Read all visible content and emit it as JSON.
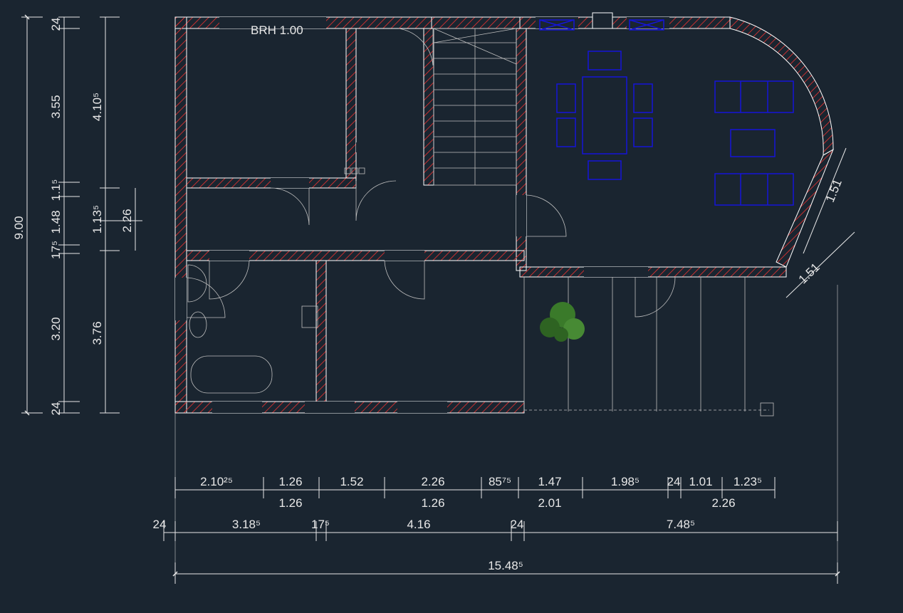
{
  "room_label": "BRH 1.00",
  "dimensions": {
    "vertical_overall": "9.00",
    "vertical_chain": [
      "24",
      "3.55",
      "1.1⁵",
      "1.48",
      "17⁵",
      "3.20",
      "24"
    ],
    "vertical_chain2": [
      "4.10⁵",
      "1.13⁵",
      "2.26",
      "3.76"
    ],
    "horizontal_row1": [
      "2.10²⁵",
      "1.26",
      "1.52",
      "2.26",
      "85⁷⁵",
      "1.47",
      "1.98⁵",
      "24",
      "1.01",
      "1.23⁵"
    ],
    "horizontal_row2": [
      "1.26",
      "1.26",
      "2.01",
      "2.26"
    ],
    "horizontal_row3": [
      "24",
      "3.18⁵",
      "17⁵",
      "4.16",
      "24",
      "7.48⁵"
    ],
    "horizontal_overall": "15.48⁵",
    "diagonal": [
      "1.51",
      "1.51"
    ]
  },
  "icons": {
    "tree": "tree-icon"
  },
  "colors": {
    "bg": "#1a2530",
    "wall_hatch": "#c53030",
    "outline": "#ffffff",
    "furniture": "#1414d8",
    "dim": "#e8e8e8",
    "plant": "#3a7a2a"
  }
}
